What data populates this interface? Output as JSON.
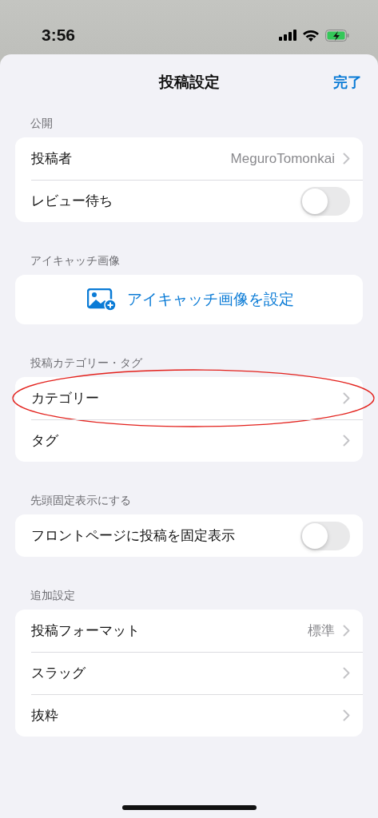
{
  "status_bar": {
    "time": "3:56"
  },
  "nav": {
    "title": "投稿設定",
    "done": "完了"
  },
  "sections": [
    {
      "header": "公開",
      "rows": [
        {
          "kind": "link",
          "label": "投稿者",
          "value": "MeguroTomonkai",
          "highlighted": false
        },
        {
          "kind": "toggle",
          "label": "レビュー待ち",
          "on": false
        }
      ]
    },
    {
      "header": "アイキャッチ画像",
      "rows": [
        {
          "kind": "action",
          "label": "アイキャッチ画像を設定"
        }
      ]
    },
    {
      "header": "投稿カテゴリー・タグ",
      "rows": [
        {
          "kind": "link",
          "label": "カテゴリー",
          "highlighted": true
        },
        {
          "kind": "link",
          "label": "タグ",
          "highlighted": false
        }
      ]
    },
    {
      "header": "先頭固定表示にする",
      "rows": [
        {
          "kind": "toggle",
          "label": "フロントページに投稿を固定表示",
          "on": false
        }
      ]
    },
    {
      "header": "追加設定",
      "rows": [
        {
          "kind": "link",
          "label": "投稿フォーマット",
          "value": "標準",
          "highlighted": false
        },
        {
          "kind": "link",
          "label": "スラッグ",
          "highlighted": false
        },
        {
          "kind": "link",
          "label": "抜粋",
          "highlighted": false
        }
      ]
    }
  ]
}
